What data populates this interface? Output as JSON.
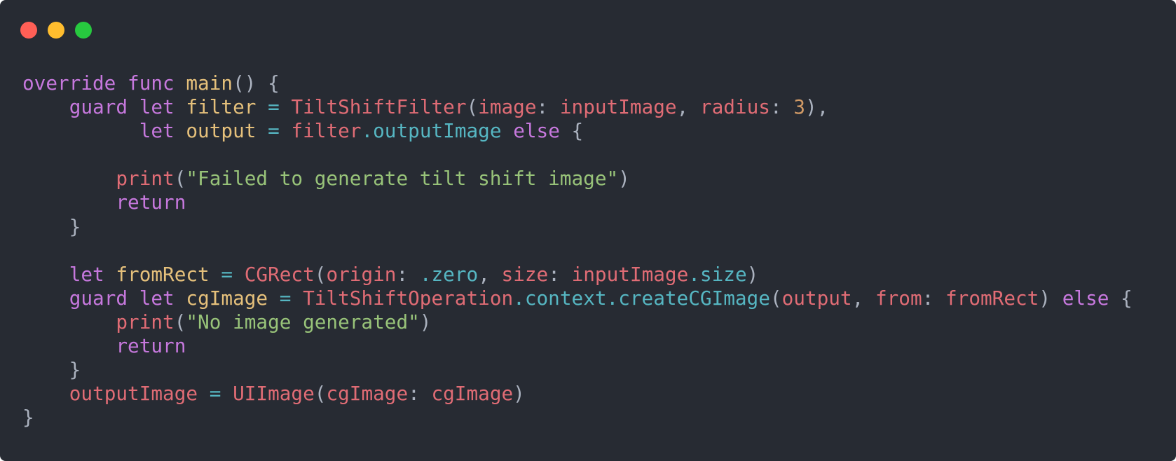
{
  "window": {
    "buttons": [
      {
        "name": "close",
        "color": "#ff5f56"
      },
      {
        "name": "minimize",
        "color": "#ffbd2e"
      },
      {
        "name": "zoom",
        "color": "#27c93f"
      }
    ],
    "background": "#272b33"
  },
  "code": {
    "lines": [
      [
        {
          "t": "override",
          "k": "keyword"
        },
        {
          "t": " ",
          "k": "default"
        },
        {
          "t": "func",
          "k": "keyword"
        },
        {
          "t": " ",
          "k": "default"
        },
        {
          "t": "main",
          "k": "decl"
        },
        {
          "t": "() {",
          "k": "default"
        }
      ],
      [
        {
          "t": "    ",
          "k": "default"
        },
        {
          "t": "guard",
          "k": "keyword"
        },
        {
          "t": " ",
          "k": "default"
        },
        {
          "t": "let",
          "k": "keyword"
        },
        {
          "t": " ",
          "k": "default"
        },
        {
          "t": "filter",
          "k": "decl"
        },
        {
          "t": " ",
          "k": "default"
        },
        {
          "t": "=",
          "k": "op"
        },
        {
          "t": " ",
          "k": "default"
        },
        {
          "t": "TiltShiftFilter",
          "k": "type"
        },
        {
          "t": "(",
          "k": "default"
        },
        {
          "t": "image",
          "k": "param"
        },
        {
          "t": ": ",
          "k": "default"
        },
        {
          "t": "inputImage",
          "k": "param"
        },
        {
          "t": ", ",
          "k": "default"
        },
        {
          "t": "radius",
          "k": "param"
        },
        {
          "t": ": ",
          "k": "default"
        },
        {
          "t": "3",
          "k": "number"
        },
        {
          "t": "),",
          "k": "default"
        }
      ],
      [
        {
          "t": "          ",
          "k": "default"
        },
        {
          "t": "let",
          "k": "keyword"
        },
        {
          "t": " ",
          "k": "default"
        },
        {
          "t": "output",
          "k": "decl"
        },
        {
          "t": " ",
          "k": "default"
        },
        {
          "t": "=",
          "k": "op"
        },
        {
          "t": " ",
          "k": "default"
        },
        {
          "t": "filter",
          "k": "param"
        },
        {
          "t": ".outputImage",
          "k": "member"
        },
        {
          "t": " ",
          "k": "default"
        },
        {
          "t": "else",
          "k": "keyword"
        },
        {
          "t": " {",
          "k": "default"
        }
      ],
      [],
      [
        {
          "t": "        ",
          "k": "default"
        },
        {
          "t": "print",
          "k": "func"
        },
        {
          "t": "(",
          "k": "default"
        },
        {
          "t": "\"Failed to generate tilt shift image\"",
          "k": "string"
        },
        {
          "t": ")",
          "k": "default"
        }
      ],
      [
        {
          "t": "        ",
          "k": "default"
        },
        {
          "t": "return",
          "k": "keyword"
        }
      ],
      [
        {
          "t": "    }",
          "k": "default"
        }
      ],
      [],
      [
        {
          "t": "    ",
          "k": "default"
        },
        {
          "t": "let",
          "k": "keyword"
        },
        {
          "t": " ",
          "k": "default"
        },
        {
          "t": "fromRect",
          "k": "decl"
        },
        {
          "t": " ",
          "k": "default"
        },
        {
          "t": "=",
          "k": "op"
        },
        {
          "t": " ",
          "k": "default"
        },
        {
          "t": "CGRect",
          "k": "type"
        },
        {
          "t": "(",
          "k": "default"
        },
        {
          "t": "origin",
          "k": "param"
        },
        {
          "t": ": ",
          "k": "default"
        },
        {
          "t": ".zero",
          "k": "member"
        },
        {
          "t": ", ",
          "k": "default"
        },
        {
          "t": "size",
          "k": "param"
        },
        {
          "t": ": ",
          "k": "default"
        },
        {
          "t": "inputImage",
          "k": "param"
        },
        {
          "t": ".size",
          "k": "member"
        },
        {
          "t": ")",
          "k": "default"
        }
      ],
      [
        {
          "t": "    ",
          "k": "default"
        },
        {
          "t": "guard",
          "k": "keyword"
        },
        {
          "t": " ",
          "k": "default"
        },
        {
          "t": "let",
          "k": "keyword"
        },
        {
          "t": " ",
          "k": "default"
        },
        {
          "t": "cgImage",
          "k": "decl"
        },
        {
          "t": " ",
          "k": "default"
        },
        {
          "t": "=",
          "k": "op"
        },
        {
          "t": " ",
          "k": "default"
        },
        {
          "t": "TiltShiftOperation",
          "k": "type"
        },
        {
          "t": ".context.createCGImage",
          "k": "member"
        },
        {
          "t": "(",
          "k": "default"
        },
        {
          "t": "output",
          "k": "param"
        },
        {
          "t": ", ",
          "k": "default"
        },
        {
          "t": "from",
          "k": "param"
        },
        {
          "t": ": ",
          "k": "default"
        },
        {
          "t": "fromRect",
          "k": "param"
        },
        {
          "t": ") ",
          "k": "default"
        },
        {
          "t": "else",
          "k": "keyword"
        },
        {
          "t": " {",
          "k": "default"
        }
      ],
      [
        {
          "t": "        ",
          "k": "default"
        },
        {
          "t": "print",
          "k": "func"
        },
        {
          "t": "(",
          "k": "default"
        },
        {
          "t": "\"No image generated\"",
          "k": "string"
        },
        {
          "t": ")",
          "k": "default"
        }
      ],
      [
        {
          "t": "        ",
          "k": "default"
        },
        {
          "t": "return",
          "k": "keyword"
        }
      ],
      [
        {
          "t": "    }",
          "k": "default"
        }
      ],
      [
        {
          "t": "    ",
          "k": "default"
        },
        {
          "t": "outputImage",
          "k": "param"
        },
        {
          "t": " ",
          "k": "default"
        },
        {
          "t": "=",
          "k": "op"
        },
        {
          "t": " ",
          "k": "default"
        },
        {
          "t": "UIImage",
          "k": "type"
        },
        {
          "t": "(",
          "k": "default"
        },
        {
          "t": "cgImage",
          "k": "param"
        },
        {
          "t": ": ",
          "k": "default"
        },
        {
          "t": "cgImage",
          "k": "param"
        },
        {
          "t": ")",
          "k": "default"
        }
      ],
      [
        {
          "t": "}",
          "k": "default"
        }
      ]
    ]
  }
}
